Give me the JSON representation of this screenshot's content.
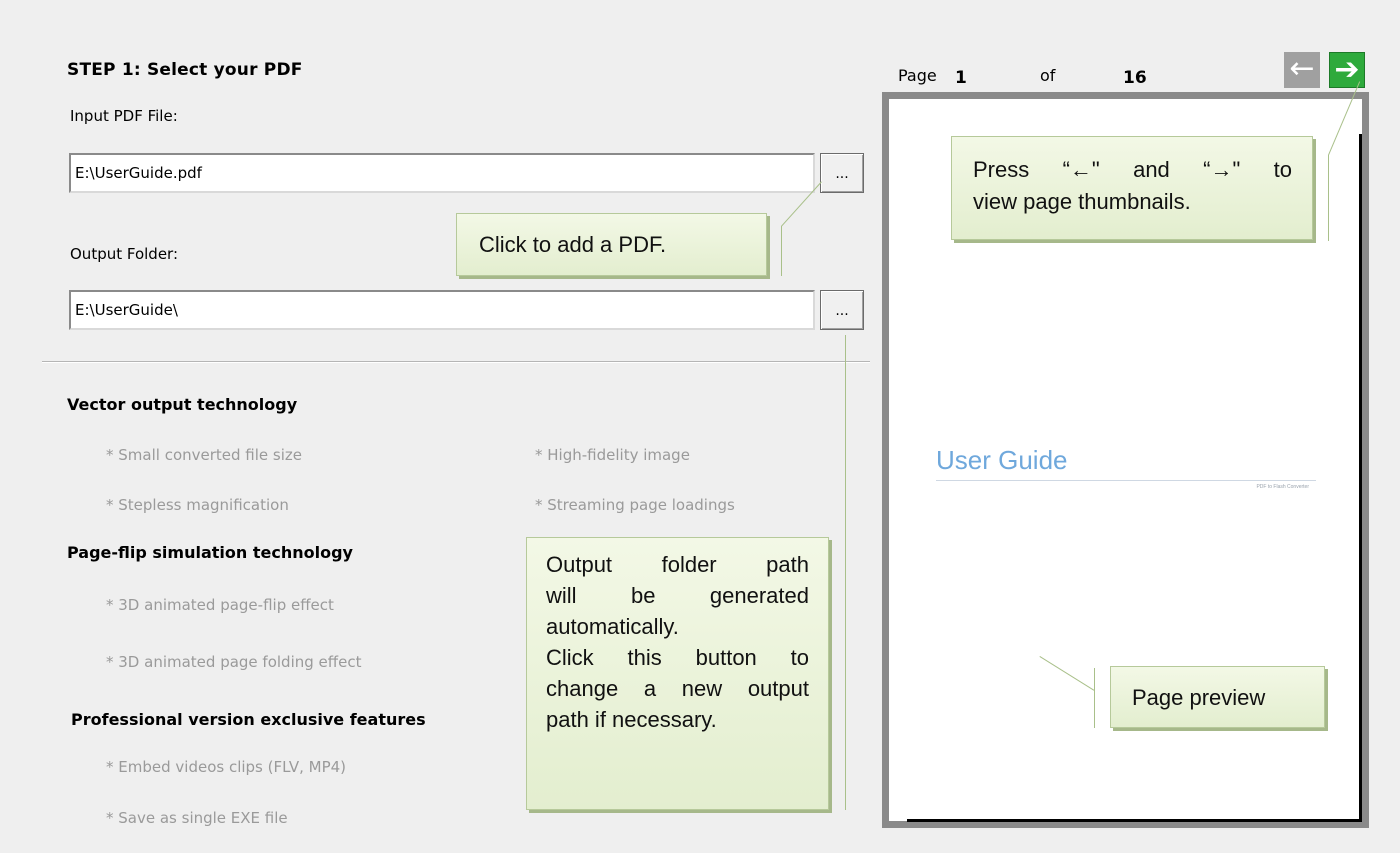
{
  "step1": {
    "title": "STEP 1:  Select your PDF",
    "input_label": "Input PDF File:",
    "input_value": "E:\\UserGuide.pdf",
    "output_label": "Output Folder:",
    "output_value": "E:\\UserGuide\\",
    "browse_label": "..."
  },
  "features": {
    "vector": {
      "heading": "Vector output technology",
      "items": [
        "* Small converted file size",
        "* High-fidelity image",
        "* Stepless magnification",
        "* Streaming page loadings"
      ]
    },
    "pageflip": {
      "heading": "Page-flip simulation technology",
      "items": [
        "* 3D animated page-flip effect",
        "* 3D animated page folding effect"
      ]
    },
    "pro": {
      "heading": "Professional version exclusive features",
      "items": [
        "* Embed videos clips (FLV, MP4)",
        "* Save as single EXE file"
      ]
    }
  },
  "callouts": {
    "add_pdf": "Click to add a PDF.",
    "output_path": [
      "Output folder path",
      "will be generated",
      "automatically.",
      "Click this button to",
      "change a new output",
      "path if necessary."
    ],
    "thumbnails": [
      "Press “←\" and “→\" to",
      "view page thumbnails."
    ],
    "preview": "Page preview"
  },
  "preview": {
    "page_label": "Page",
    "current_page": "1",
    "of_label": "of",
    "total_pages": "16",
    "doc_title": "User Guide",
    "doc_subtitle": "PDF to Flash Converter"
  },
  "nav": {
    "prev_icon": "arrow-left-icon",
    "next_icon": "arrow-right-icon",
    "prev_color": "#a0a0a0",
    "next_color": "#2eaa3c"
  },
  "colors": {
    "callout_bg": "#e8f1d8",
    "callout_border": "#b6c99a",
    "feature_text": "#9a9a9a",
    "doc_title": "#6fa8dc"
  }
}
